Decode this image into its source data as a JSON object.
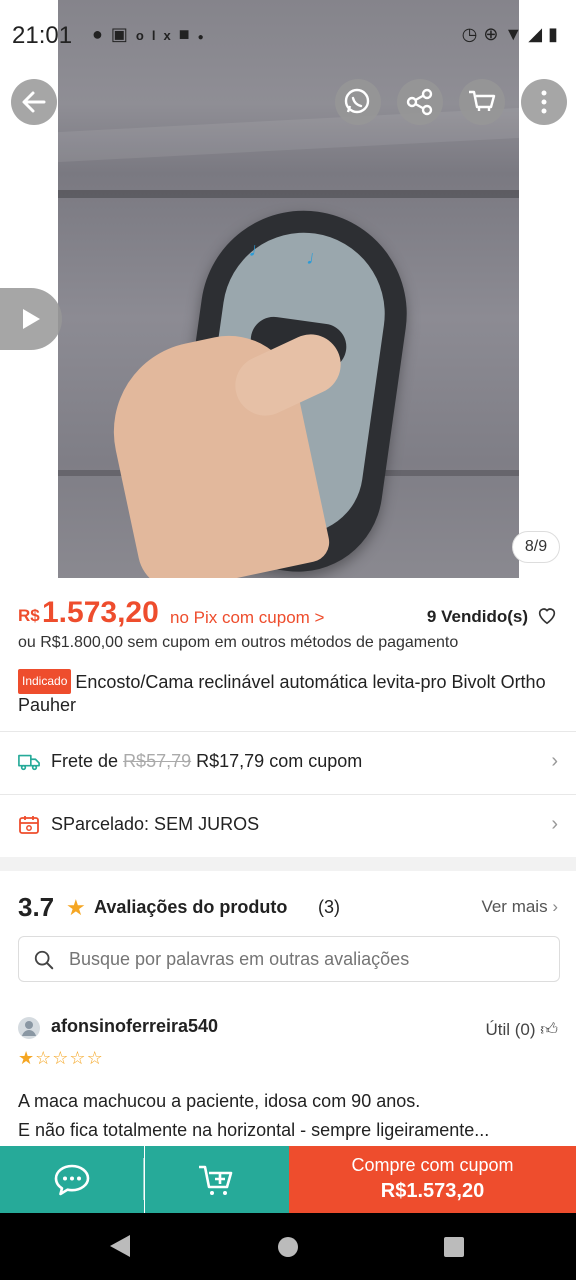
{
  "status_bar": {
    "time": "21:01",
    "left_icons": [
      "chat-bubble-icon",
      "shopping-bag-icon",
      "olx-icon",
      "square-icon",
      "dot-icon"
    ],
    "right_icons": [
      "alarm-icon",
      "data-saver-icon",
      "wifi-icon",
      "signal-icon",
      "battery-icon"
    ]
  },
  "gallery": {
    "counter": "8/9"
  },
  "product": {
    "price_currency": "R$",
    "price_value": "1.573,20",
    "pix_label": "no Pix com cupom >",
    "sold": "9 Vendido(s)",
    "alt_price": "ou R$1.800,00 sem cupom em outros métodos de pagamento",
    "badge": "Indicado",
    "title": "Encosto/Cama reclinável automática levita-pro Bivolt Ortho Pauher"
  },
  "shipping": {
    "prefix": "Frete de",
    "old_price": "R$57,79",
    "new_price": "R$17,79 com cupom"
  },
  "installments": {
    "label": "SParcelado: SEM JUROS"
  },
  "ratings": {
    "score": "3.7",
    "title": "Avaliações do produto",
    "count": "(3)",
    "see_more": "Ver mais",
    "search_placeholder": "Busque por palavras em outras avaliações"
  },
  "review": {
    "reviewer": "afonsinoferreira540",
    "useful": "Útil (0)",
    "stars": 1,
    "stars_max": 5,
    "line1": "A maca machucou a paciente, idosa com 90 anos.",
    "line2": "E não fica totalmente na horizontal - sempre ligeiramente..."
  },
  "action_bar": {
    "buy_line1": "Compre com cupom",
    "buy_line2": "R$1.573,20"
  },
  "colors": {
    "accent": "#ee4d2d",
    "teal": "#26aa99",
    "star": "#f5a623"
  }
}
